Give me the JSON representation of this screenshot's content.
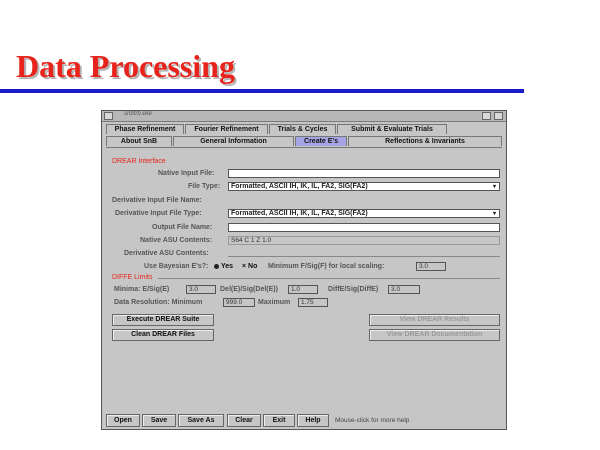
{
  "slide": {
    "title": "Data Processing"
  },
  "window": {
    "title": "snbfrb.exe",
    "main_tabs": [
      {
        "label": "Phase Refinement"
      },
      {
        "label": "Fourier Refinement"
      },
      {
        "label": "Trials & Cycles"
      },
      {
        "label": "Submit & Evaluate Trials"
      }
    ],
    "sub_tabs": [
      {
        "label": "About SnB"
      },
      {
        "label": "General Information"
      },
      {
        "label": "Create E's"
      },
      {
        "label": "Reflections & Invariants"
      }
    ],
    "sub_tab_active": "Create E's",
    "drear_section": "DREAR Interface",
    "native_input_file": {
      "label": "Native Input File:",
      "value": ""
    },
    "file_type": {
      "label": "File Type:",
      "value": "Formatted, ASCII IH, IK, IL, FA2, SIG(FA2)"
    },
    "derivative_input_file_name": {
      "label": "Derivative Input File Name:"
    },
    "derivative_input_file_type": {
      "label": "Derivative Input File Type:",
      "value": "Formatted, ASCII IH, IK, IL, FA2, SIG(FA2)"
    },
    "output_file_name": {
      "label": "Output File Name:",
      "value": ""
    },
    "native_asu_contents": {
      "label": "Native ASU Contents:",
      "value": "S64 C 1 Z 1.0"
    },
    "derivative_asu_contents": {
      "label": "Derivative ASU Contents:"
    },
    "bayesian": {
      "label": "Use Bayesian E's?:",
      "yes": "Yes",
      "no": "No"
    },
    "min_f_sig": {
      "label": "Minimum F/Sig(F) for local scaling:",
      "value": "3.0"
    },
    "diffe_section": "DIFFE Limits",
    "minima": {
      "label": "Minima:",
      "e_sig_label": "E/Sig(E)",
      "e_sig_value": "3.0",
      "dele_label": "Del(E)/Sig(Del(E))",
      "dele_value": "1.0",
      "diffe_label": "DiffE/Sig(DiffE)",
      "diffe_value": "3.0"
    },
    "data_resolution": {
      "label": "Data Resolution:",
      "min_label": "Minimum",
      "min_value": "999.0",
      "max_label": "Maximum",
      "max_value": "1.75"
    },
    "buttons": {
      "execute": "Execute DREAR Suite",
      "clean": "Clean DREAR Files",
      "view_results": "View DREAR Results",
      "view_docs": "View DREAR Documentation"
    },
    "bottom": {
      "open": "Open",
      "save": "Save",
      "save_as": "Save As",
      "clear": "Clear",
      "exit": "Exit",
      "help": "Help",
      "status": "Mouse-click for more help"
    }
  }
}
